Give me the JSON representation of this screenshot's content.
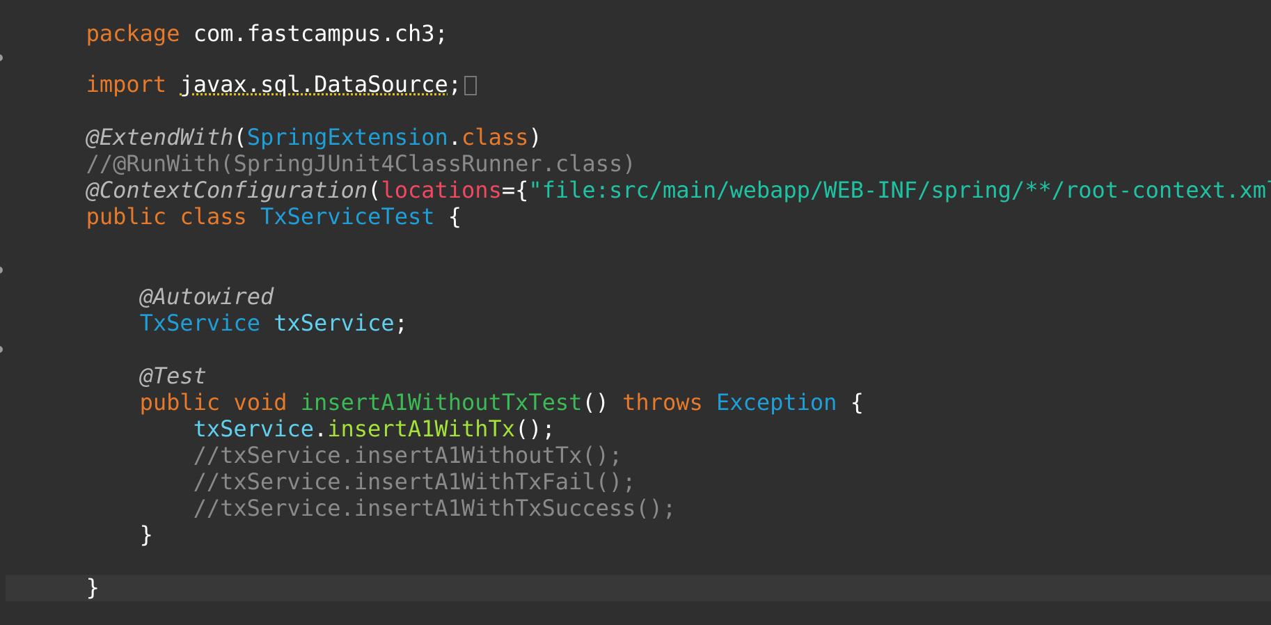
{
  "editor": {
    "lines": {
      "package": {
        "kw": "package",
        "rest": " com.fastcampus.ch3;"
      },
      "import": {
        "kw": "import",
        "target": "javax.sql.DataSource",
        "semi": ";"
      },
      "extend_with": {
        "anno": "@ExtendWith",
        "open": "(",
        "type": "SpringExtension",
        "dot": ".",
        "kw": "class",
        "close": ")"
      },
      "run_with_comment": "//@RunWith(SpringJUnit4ClassRunner.class)",
      "context_config": {
        "anno": "@ContextConfiguration",
        "open": "(",
        "attr": "locations",
        "eq": "={",
        "str": "\"file:src/main/webapp/WEB-INF/spring/**/root-context.xml\"",
        "close": "})"
      },
      "class_decl": {
        "kw": "public class ",
        "type": "TxServiceTest",
        "brace": " {"
      },
      "autowired": "@Autowired",
      "field_decl": {
        "type": "TxService",
        "space": " ",
        "name": "txService",
        "semi": ";"
      },
      "test_anno": "@Test",
      "method_decl": {
        "kw1": "public void ",
        "name": "insertA1WithoutTxTest",
        "parens": "() ",
        "kw2": "throws ",
        "type": "Exception",
        "brace": " {"
      },
      "call_line": {
        "obj": "txService",
        "dot": ".",
        "method": "insertA1WithTx",
        "end": "();"
      },
      "comment1": "//txService.insertA1WithoutTx();",
      "comment2": "//txService.insertA1WithTxFail();",
      "comment3": "//txService.insertA1WithTxSuccess();",
      "method_close": "}",
      "class_close": "}"
    }
  }
}
